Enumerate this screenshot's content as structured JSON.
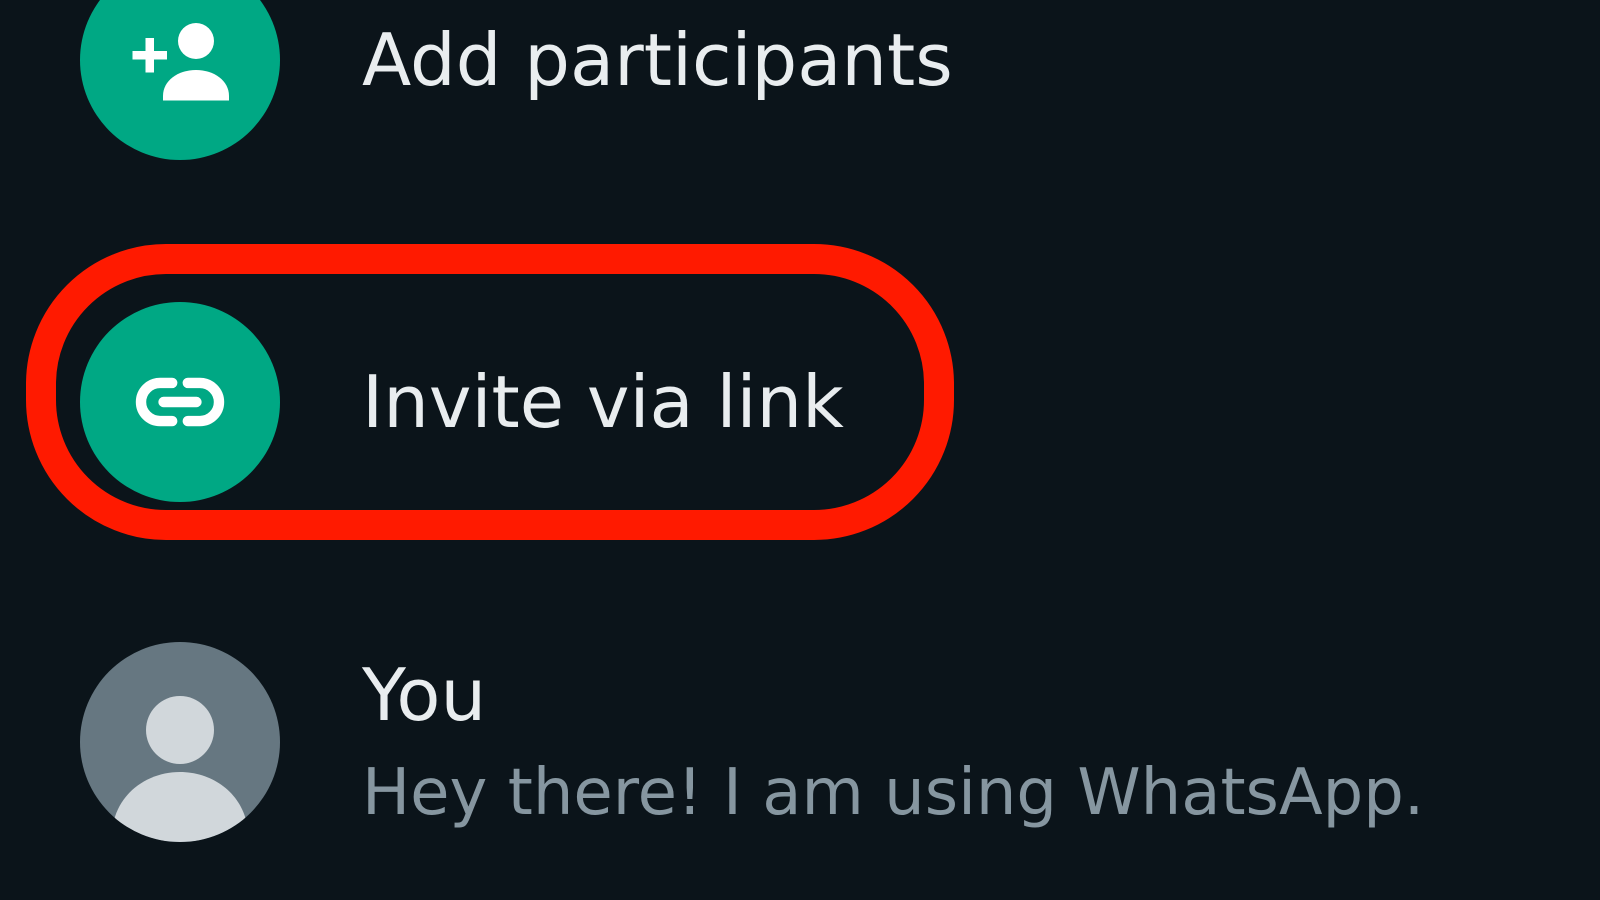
{
  "colors": {
    "background": "#0b141a",
    "accent": "#00a884",
    "avatar_grey": "#667781",
    "primary_text": "#e9edef",
    "secondary_text": "#8696a0",
    "highlight": "#ff1a00"
  },
  "actions": [
    {
      "label": "Add participants",
      "icon": "add-person-icon"
    },
    {
      "label": "Invite via link",
      "icon": "link-icon"
    }
  ],
  "participants": [
    {
      "name": "You",
      "status": "Hey there! I am using WhatsApp.",
      "icon": "default-avatar-icon"
    }
  ]
}
